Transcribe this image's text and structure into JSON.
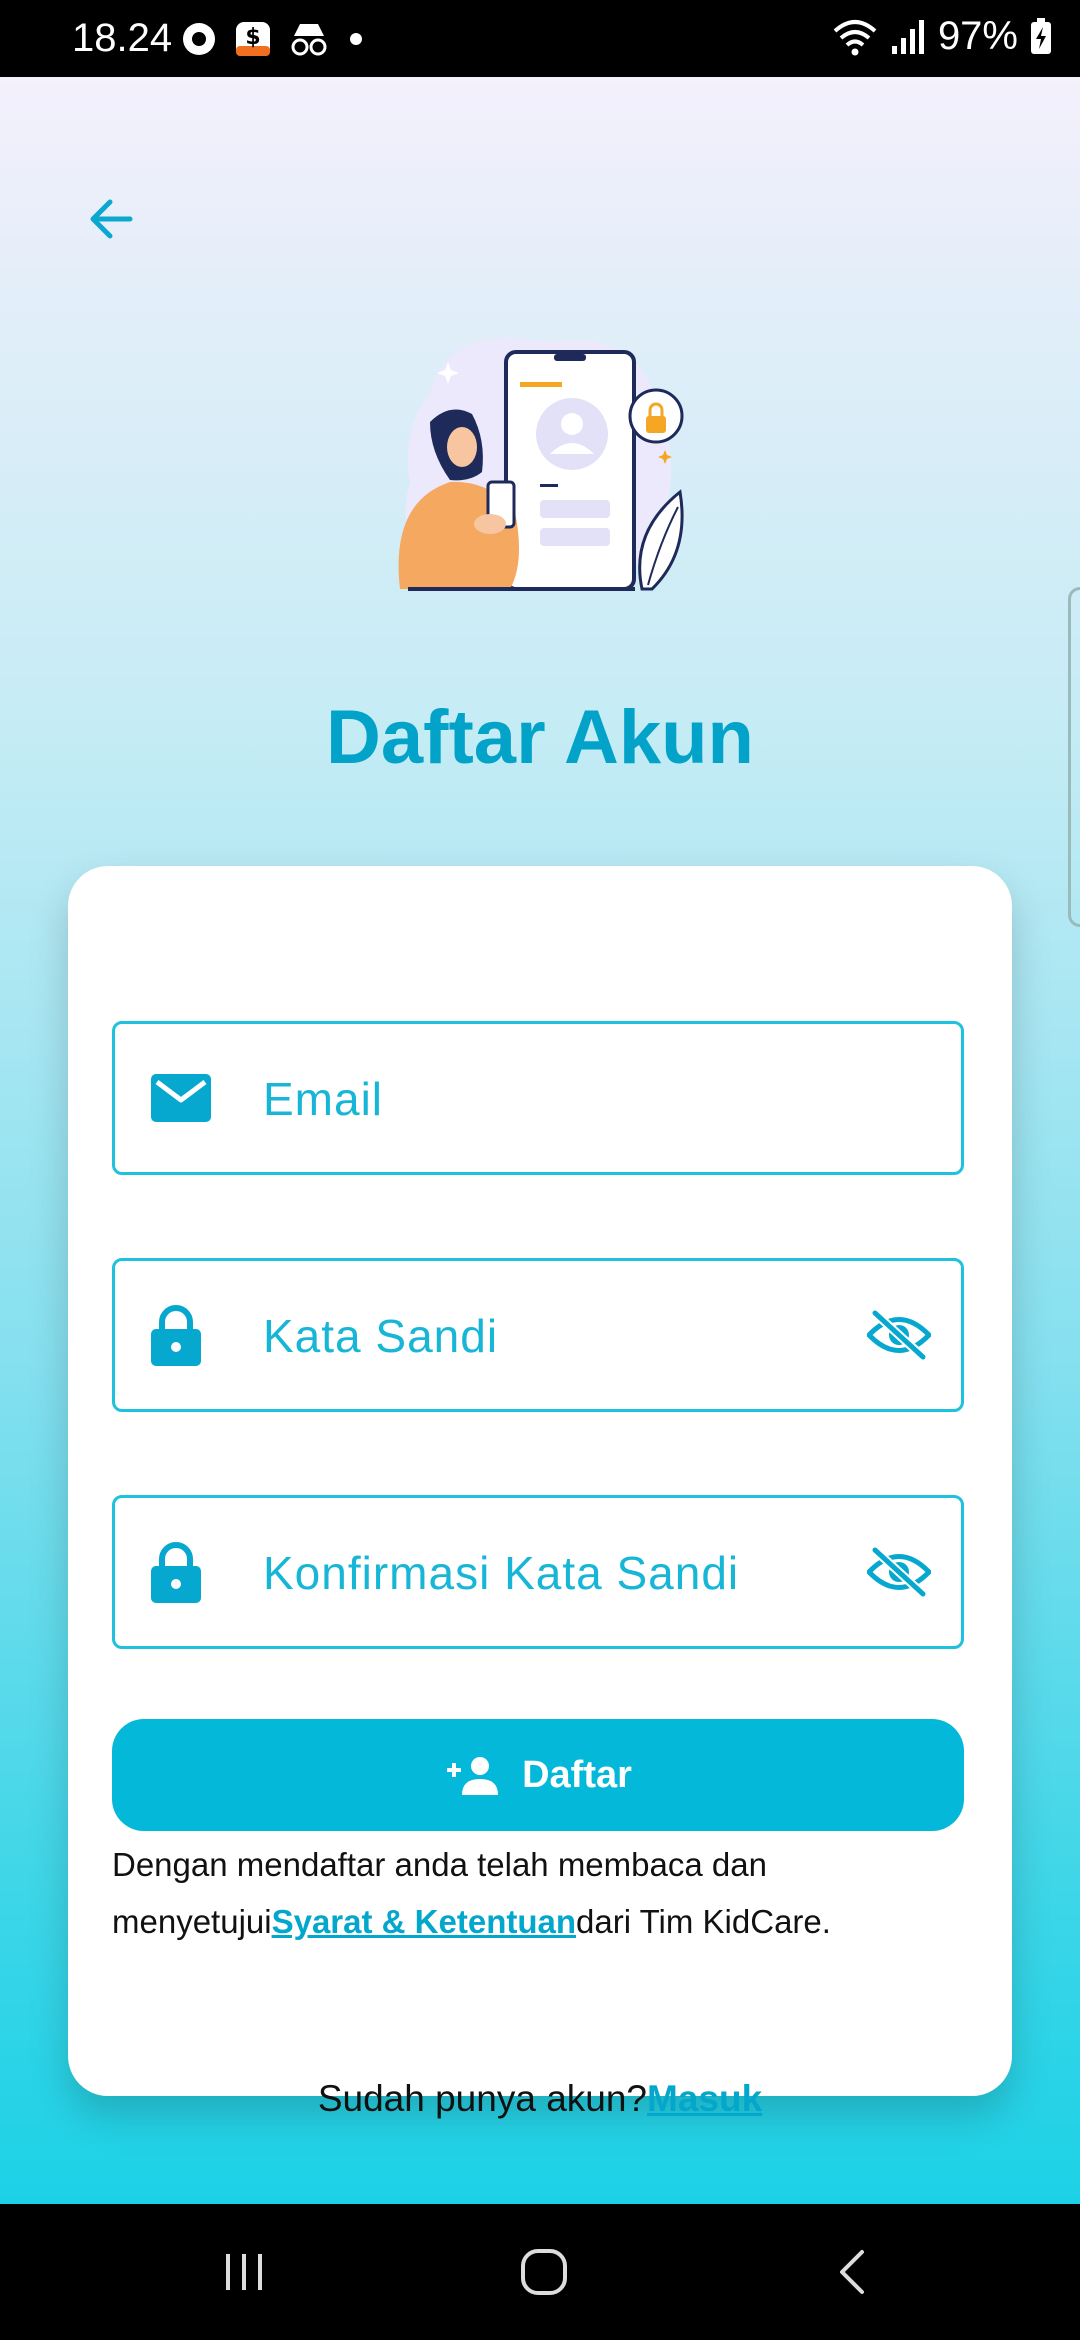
{
  "status_bar": {
    "time": "18.24",
    "battery": "97%"
  },
  "page": {
    "title": "Daftar Akun"
  },
  "form": {
    "email_placeholder": "Email",
    "password_placeholder": "Kata Sandi",
    "confirm_placeholder": "Konfirmasi Kata Sandi",
    "submit_label": "Daftar"
  },
  "terms": {
    "text_before": "Dengan mendaftar anda telah membaca dan menyetujui",
    "link": "Syarat & Ketentuan",
    "text_after": "dari Tim KidCare."
  },
  "login": {
    "prompt": "Sudah punya akun?",
    "link": "Masuk"
  },
  "colors": {
    "accent": "#03B8D8",
    "title": "#03A3C9",
    "field_border": "#1EC2DF"
  },
  "icons": {
    "back": "arrow-left-icon",
    "email": "mail-icon",
    "password": "lock-icon",
    "toggle": "eye-off-icon",
    "submit": "person-add-icon"
  }
}
